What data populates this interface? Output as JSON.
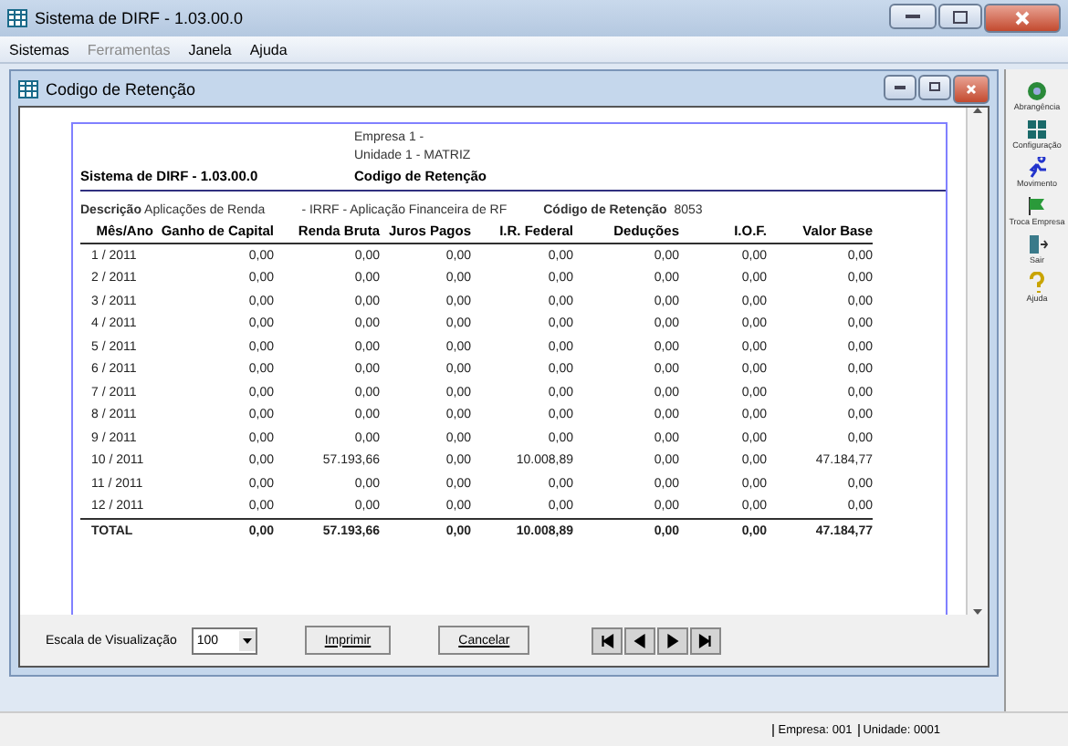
{
  "window": {
    "title": "Sistema de DIRF - 1.03.00.0"
  },
  "menu": [
    {
      "label": "Sistemas",
      "disabled": false
    },
    {
      "label": "Ferramentas",
      "disabled": true
    },
    {
      "label": "Janela",
      "disabled": false
    },
    {
      "label": "Ajuda",
      "disabled": false
    }
  ],
  "child_window": {
    "title": "Codigo de Retenção"
  },
  "report": {
    "company": "Empresa 1 -",
    "unit": "Unidade 1 - MATRIZ",
    "system": "Sistema de DIRF - 1.03.00.0",
    "title": "Codigo de Retenção",
    "description_label": "Descrição",
    "description": "Aplicações de Renda",
    "irrf": "- IRRF - Aplicação Financeira de RF",
    "code_label": "Código de Retenção",
    "code": "8053",
    "columns": [
      "Mês/Ano",
      "Ganho de Capital",
      "Renda Bruta",
      "Juros Pagos",
      "I.R. Federal",
      "Deduções",
      "I.O.F.",
      "Valor Base"
    ],
    "rows": [
      [
        "1 / 2011",
        "0,00",
        "0,00",
        "0,00",
        "0,00",
        "0,00",
        "0,00",
        "0,00"
      ],
      [
        "2 / 2011",
        "0,00",
        "0,00",
        "0,00",
        "0,00",
        "0,00",
        "0,00",
        "0,00"
      ],
      [
        "3 / 2011",
        "0,00",
        "0,00",
        "0,00",
        "0,00",
        "0,00",
        "0,00",
        "0,00"
      ],
      [
        "4 / 2011",
        "0,00",
        "0,00",
        "0,00",
        "0,00",
        "0,00",
        "0,00",
        "0,00"
      ],
      [
        "5 / 2011",
        "0,00",
        "0,00",
        "0,00",
        "0,00",
        "0,00",
        "0,00",
        "0,00"
      ],
      [
        "6 / 2011",
        "0,00",
        "0,00",
        "0,00",
        "0,00",
        "0,00",
        "0,00",
        "0,00"
      ],
      [
        "7 / 2011",
        "0,00",
        "0,00",
        "0,00",
        "0,00",
        "0,00",
        "0,00",
        "0,00"
      ],
      [
        "8 / 2011",
        "0,00",
        "0,00",
        "0,00",
        "0,00",
        "0,00",
        "0,00",
        "0,00"
      ],
      [
        "9 / 2011",
        "0,00",
        "0,00",
        "0,00",
        "0,00",
        "0,00",
        "0,00",
        "0,00"
      ],
      [
        "10 / 2011",
        "0,00",
        "57.193,66",
        "0,00",
        "10.008,89",
        "0,00",
        "0,00",
        "47.184,77"
      ],
      [
        "11 / 2011",
        "0,00",
        "0,00",
        "0,00",
        "0,00",
        "0,00",
        "0,00",
        "0,00"
      ],
      [
        "12 / 2011",
        "0,00",
        "0,00",
        "0,00",
        "0,00",
        "0,00",
        "0,00",
        "0,00"
      ]
    ],
    "total": [
      "TOTAL",
      "0,00",
      "57.193,66",
      "0,00",
      "10.008,89",
      "0,00",
      "0,00",
      "47.184,77"
    ]
  },
  "footer": {
    "scale_label": "Escala de Visualização",
    "scale": "100",
    "buttons": [
      "Imprimir",
      "Cancelar"
    ]
  },
  "toolbar": [
    {
      "label": "Abrangência",
      "kind": "globe"
    },
    {
      "label": "Configuração",
      "kind": "grid"
    },
    {
      "label": "Movimento",
      "kind": "runner"
    },
    {
      "label": "Troca Empresa",
      "kind": "flag"
    },
    {
      "label": "Sair",
      "kind": "door"
    },
    {
      "label": "Ajuda",
      "kind": "help"
    }
  ],
  "status_bar": [
    "Empresa: 001",
    "Unidade: 0001"
  ]
}
